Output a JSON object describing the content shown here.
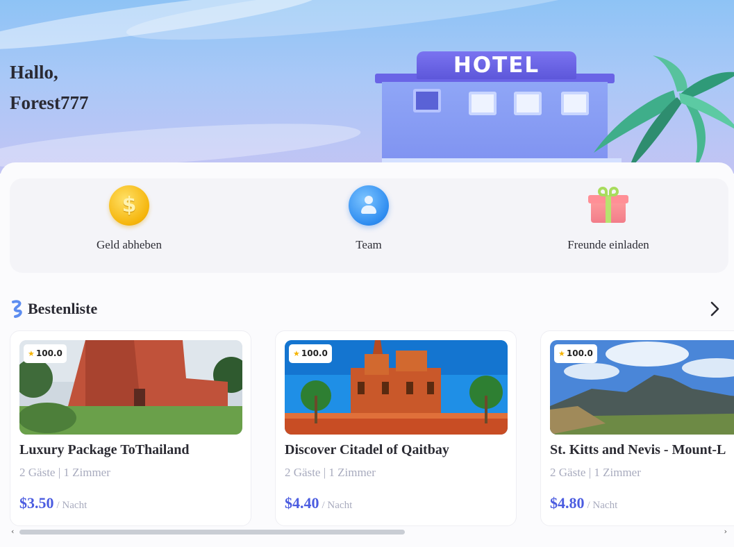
{
  "hero": {
    "greeting": "Hallo,",
    "username": "Forest777",
    "hotel_sign": "HOTEL"
  },
  "quick_actions": [
    {
      "label": "Geld abheben",
      "icon": "coin-icon"
    },
    {
      "label": "Team",
      "icon": "team-icon"
    },
    {
      "label": "Freunde einladen",
      "icon": "gift-icon"
    }
  ],
  "leaderboard": {
    "title": "Bestenliste",
    "more_icon": "chevron-right-icon",
    "cards": [
      {
        "rating": "100.0",
        "title": "Luxury Package ToThailand",
        "subtitle": "2 Gäste | 1 Zimmer",
        "price": "$3.50",
        "unit": "/ Nacht"
      },
      {
        "rating": "100.0",
        "title": "Discover Citadel of Qaitbay",
        "subtitle": "2 Gäste | 1 Zimmer",
        "price": "$4.40",
        "unit": "/ Nacht"
      },
      {
        "rating": "100.0",
        "title": "St. Kitts and Nevis - Mount-L",
        "subtitle": "2 Gäste | 1 Zimmer",
        "price": "$4.80",
        "unit": "/ Nacht"
      }
    ]
  },
  "colors": {
    "accent": "#4b5ce0",
    "muted_text": "#a8abbe",
    "panel_bg": "#f4f4f8"
  }
}
